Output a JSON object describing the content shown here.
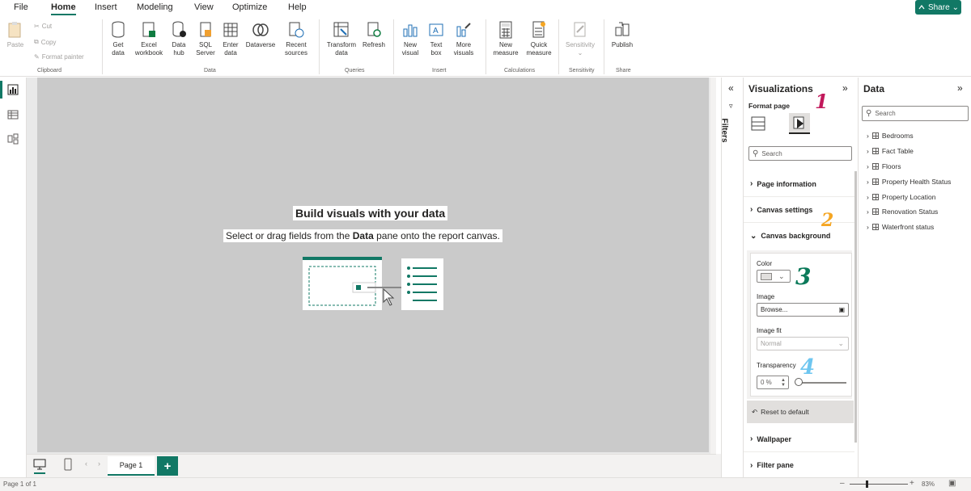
{
  "menu": {
    "items": [
      "File",
      "Home",
      "Insert",
      "Modeling",
      "View",
      "Optimize",
      "Help"
    ],
    "active": "Home",
    "share_label": "Share"
  },
  "ribbon": {
    "clipboard": {
      "paste": "Paste",
      "cut": "Cut",
      "copy": "Copy",
      "format_painter": "Format painter",
      "label": "Clipboard"
    },
    "data": {
      "get_data": "Get data",
      "excel": "Excel workbook",
      "data_hub": "Data hub",
      "sql": "SQL Server",
      "enter": "Enter data",
      "dataverse": "Dataverse",
      "recent": "Recent sources",
      "label": "Data"
    },
    "queries": {
      "transform": "Transform data",
      "refresh": "Refresh",
      "label": "Queries"
    },
    "insert": {
      "new_visual": "New visual",
      "text_box": "Text box",
      "more": "More visuals",
      "label": "Insert"
    },
    "calculations": {
      "new_measure": "New measure",
      "quick_measure": "Quick measure",
      "label": "Calculations"
    },
    "sensitivity": {
      "btn": "Sensitivity",
      "label": "Sensitivity"
    },
    "share": {
      "publish": "Publish",
      "label": "Share"
    }
  },
  "canvas": {
    "title": "Build visuals with your data",
    "subtitle_pre": "Select or drag fields from the ",
    "subtitle_bold": "Data",
    "subtitle_post": " pane onto the report canvas."
  },
  "filters": {
    "label": "Filters"
  },
  "visualizations": {
    "title": "Visualizations",
    "format_page": "Format page",
    "search_placeholder": "Search",
    "sections": {
      "page_info": "Page information",
      "canvas_settings": "Canvas settings",
      "canvas_background": "Canvas background",
      "wallpaper": "Wallpaper",
      "filter_pane": "Filter pane"
    },
    "color_label": "Color",
    "image_label": "Image",
    "image_value": "Browse...",
    "image_fit_label": "Image fit",
    "image_fit_value": "Normal",
    "transparency_label": "Transparency",
    "transparency_value": "0 %",
    "transparency_level": 0,
    "reset": "Reset to default"
  },
  "annotations": {
    "one": "1",
    "two": "2",
    "three": "3",
    "four": "4"
  },
  "data_pane": {
    "title": "Data",
    "search_placeholder": "Search",
    "tables": [
      "Bedrooms",
      "Fact Table",
      "Floors",
      "Property Health Status",
      "Property Location",
      "Renovation Status",
      "Waterfront status"
    ]
  },
  "page_tabs": {
    "tab": "Page 1",
    "add": "+"
  },
  "status": {
    "page": "Page 1 of 1",
    "zoom": "83%"
  },
  "colors": {
    "accent": "#117865",
    "annotation_1": "#c2185b",
    "annotation_2": "#f5a623",
    "annotation_3": "#0b7a5a",
    "annotation_4": "#6ec6f0"
  }
}
